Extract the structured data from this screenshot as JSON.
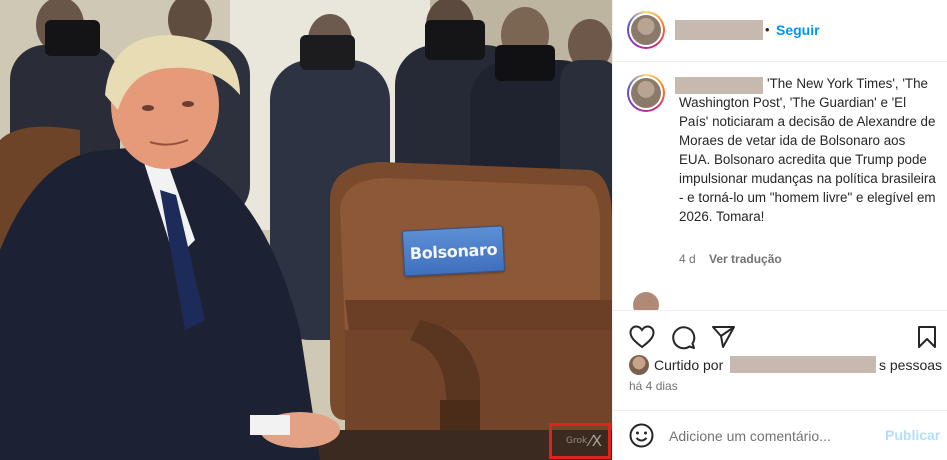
{
  "photo": {
    "name_plate": "Bolsonaro",
    "watermark_text": "Grok",
    "watermark_mark": "X̷"
  },
  "header": {
    "dot": "•",
    "follow_label": "Seguir"
  },
  "caption": {
    "text": "'The New York Times', 'The Washington Post', 'The Guardian' e 'El País' noticiaram a decisão de Alexandre de Moraes de vetar ida de Bolsonaro aos EUA. Bolsonaro acredita que Trump pode impulsionar mudanças na política brasileira - e torná-lo um \"homem livre\" e elegível em 2026. Tomara!",
    "age": "4 d",
    "translate_label": "Ver tradução"
  },
  "actions": {
    "icons": [
      "heart-icon",
      "comment-icon",
      "share-icon",
      "bookmark-icon"
    ]
  },
  "likes": {
    "prefix": "Curtido por",
    "suffix": "s pessoas"
  },
  "time_ago": "há 4 dias",
  "comment": {
    "placeholder": "Adicione um comentário...",
    "publish_label": "Publicar"
  },
  "colors": {
    "follow_blue": "#0095f6",
    "publish_disabled": "#b2dffc",
    "watermark_box": "#e0241b",
    "name_plate": "#4a7cc8"
  }
}
